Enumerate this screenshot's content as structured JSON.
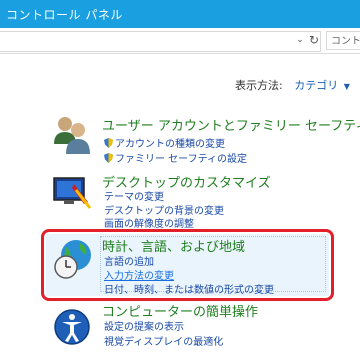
{
  "window": {
    "title": "コントロール パネル"
  },
  "search": {
    "placeholder": "コント"
  },
  "view_by": {
    "label": "表示方法:",
    "value": "カテゴリ"
  },
  "categories": [
    {
      "title": "ユーザー アカウントとファミリー セーフティ",
      "icon": "users-icon",
      "links": [
        "アカウントの種類の変更",
        "ファミリー セーフティの設定"
      ]
    },
    {
      "title": "デスクトップのカスタマイズ",
      "icon": "desktop-icon",
      "links": [
        "テーマの変更",
        "デスクトップの背景の変更",
        "画面の解像度の調整"
      ]
    },
    {
      "title": "時計、言語、および地域",
      "icon": "clock-globe-icon",
      "links": [
        "言語の追加",
        "入力方法の変更",
        "日付、時刻、または数値の形式の変更"
      ]
    },
    {
      "title": "コンピューターの簡単操作",
      "icon": "ease-of-access-icon",
      "links": [
        "設定の提案の表示",
        "視覚ディスプレイの最適化"
      ]
    }
  ],
  "colors": {
    "titlebar": "#1aa0e0",
    "category_title": "#1e7e1e",
    "link": "#1a4aa8",
    "highlight": "#e3202a"
  }
}
